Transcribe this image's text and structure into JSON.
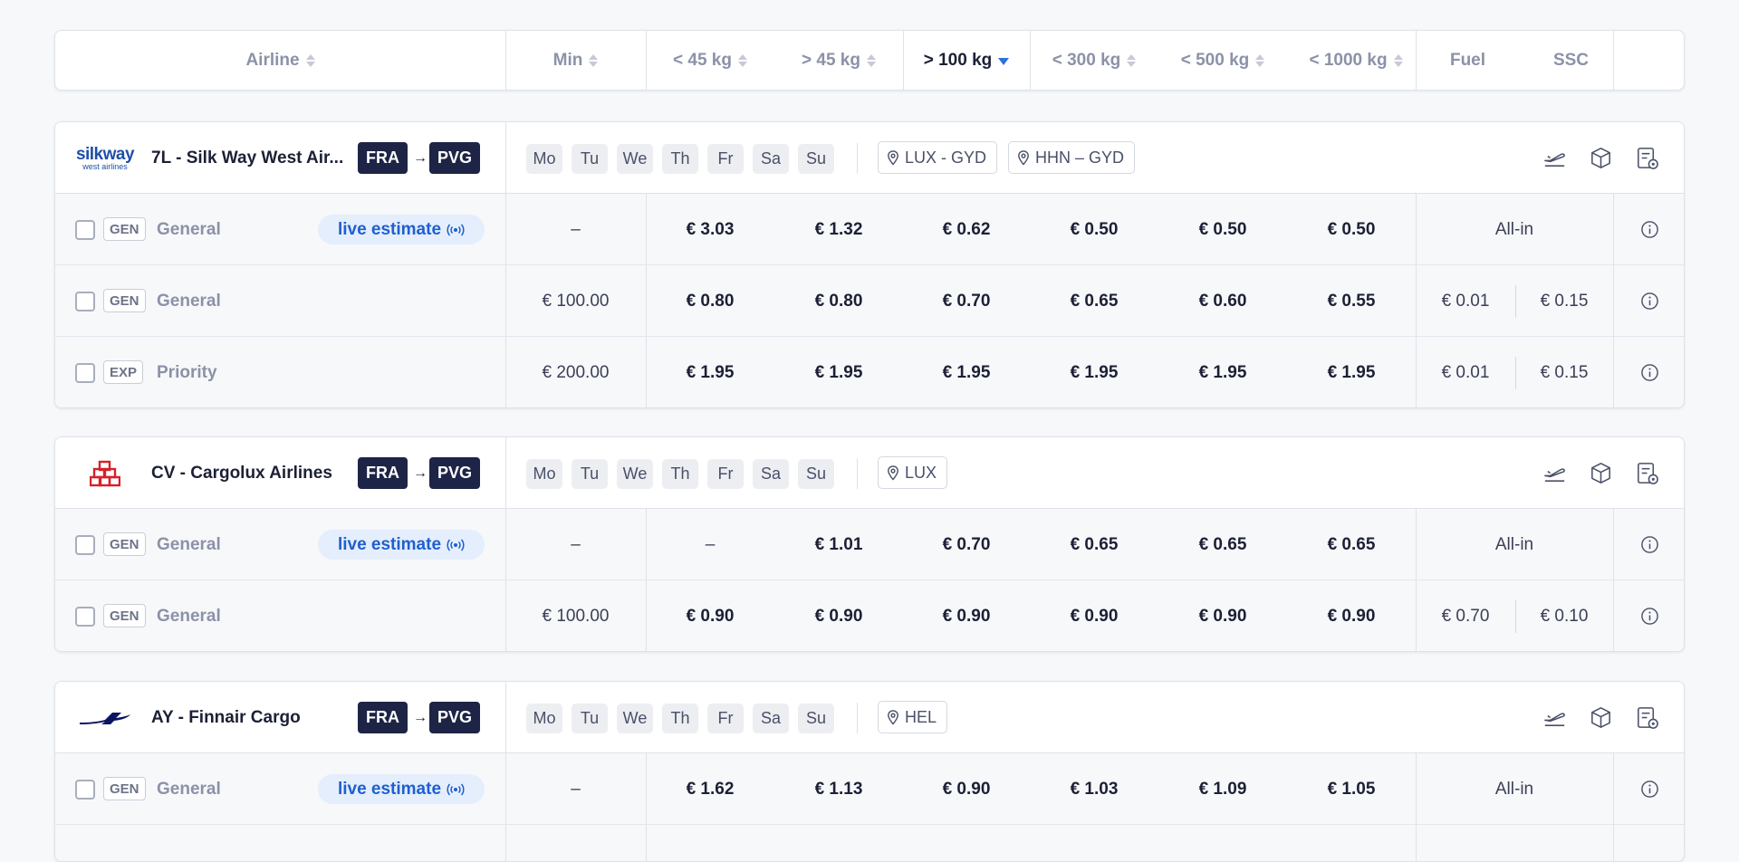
{
  "header": {
    "airline": "Airline",
    "min": "Min",
    "lt45": "< 45 kg",
    "gt45": "> 45 kg",
    "gt100": "> 100 kg",
    "lt300": "< 300 kg",
    "lt500": "< 500 kg",
    "lt1000": "< 1000 kg",
    "fuel": "Fuel",
    "ssc": "SSC"
  },
  "days": [
    "Mo",
    "Tu",
    "We",
    "Th",
    "Fr",
    "Sa",
    "Su"
  ],
  "cards": [
    {
      "logo": "silkway-logo",
      "logo_text": "silkway",
      "logo_sub": "west airlines",
      "airline": "7L - Silk Way West Air...",
      "origin": "FRA",
      "destination": "PVG",
      "locations": [
        "LUX - GYD",
        "HHN – GYD"
      ],
      "rows": [
        {
          "class": "GEN",
          "service": "General",
          "live": "live estimate",
          "min": "–",
          "rates": [
            "€ 3.03",
            "€ 1.32",
            "€ 0.62",
            "€ 0.50",
            "€ 0.50",
            "€ 0.50"
          ],
          "allin": "All-in"
        },
        {
          "class": "GEN",
          "service": "General",
          "min": "€ 100.00",
          "rates": [
            "€ 0.80",
            "€ 0.80",
            "€ 0.70",
            "€ 0.65",
            "€ 0.60",
            "€ 0.55"
          ],
          "fuel": "€ 0.01",
          "ssc": "€ 0.15"
        },
        {
          "class": "EXP",
          "service": "Priority",
          "min": "€ 200.00",
          "rates": [
            "€ 1.95",
            "€ 1.95",
            "€ 1.95",
            "€ 1.95",
            "€ 1.95",
            "€ 1.95"
          ],
          "fuel": "€ 0.01",
          "ssc": "€ 0.15"
        }
      ]
    },
    {
      "logo": "cargolux-logo",
      "airline": "CV - Cargolux Airlines",
      "origin": "FRA",
      "destination": "PVG",
      "locations": [
        "LUX"
      ],
      "rows": [
        {
          "class": "GEN",
          "service": "General",
          "live": "live estimate",
          "min": "–",
          "rates": [
            "–",
            "€ 1.01",
            "€ 0.70",
            "€ 0.65",
            "€ 0.65",
            "€ 0.65"
          ],
          "allin": "All-in"
        },
        {
          "class": "GEN",
          "service": "General",
          "min": "€ 100.00",
          "rates": [
            "€ 0.90",
            "€ 0.90",
            "€ 0.90",
            "€ 0.90",
            "€ 0.90",
            "€ 0.90"
          ],
          "fuel": "€ 0.70",
          "ssc": "€ 0.10"
        }
      ]
    },
    {
      "logo": "finnair-logo",
      "airline": "AY - Finnair Cargo",
      "origin": "FRA",
      "destination": "PVG",
      "locations": [
        "HEL"
      ],
      "rows": [
        {
          "class": "GEN",
          "service": "General",
          "live": "live estimate",
          "min": "–",
          "rates": [
            "€ 1.62",
            "€ 1.13",
            "€ 0.90",
            "€ 1.03",
            "€ 1.09",
            "€ 1.05"
          ],
          "allin": "All-in"
        }
      ]
    }
  ],
  "colors": {
    "navy": "#1e2446",
    "accent": "#2e6fe0",
    "live_bg": "#e4eefc",
    "cargolux_red": "#d6202a"
  }
}
